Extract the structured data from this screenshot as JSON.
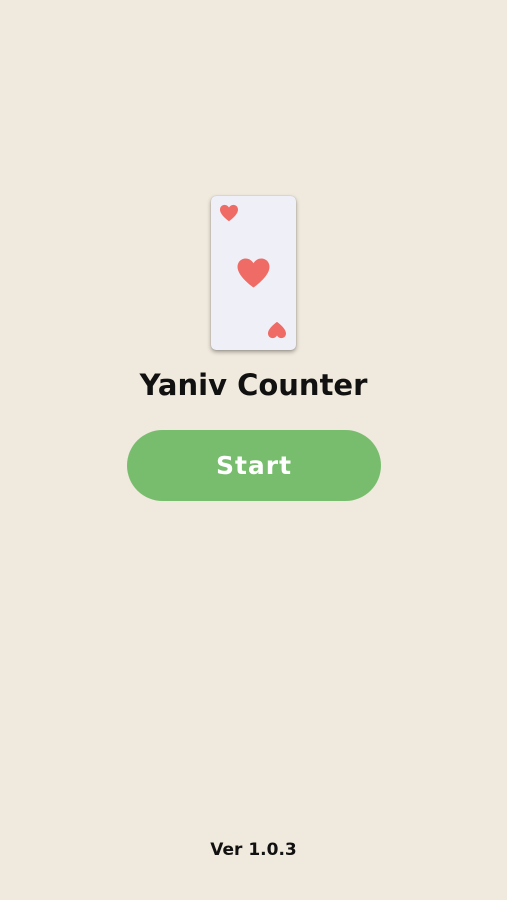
{
  "app": {
    "title": "Yaniv Counter",
    "version": "Ver 1.0.3"
  },
  "actions": {
    "start_label": "Start"
  },
  "logo": {
    "icon": "heart-card-icon",
    "suit_color": "#ef6b66",
    "card_color": "#eff0f7"
  },
  "theme": {
    "background": "#f0e9dd",
    "accent": "#78bd6e"
  }
}
